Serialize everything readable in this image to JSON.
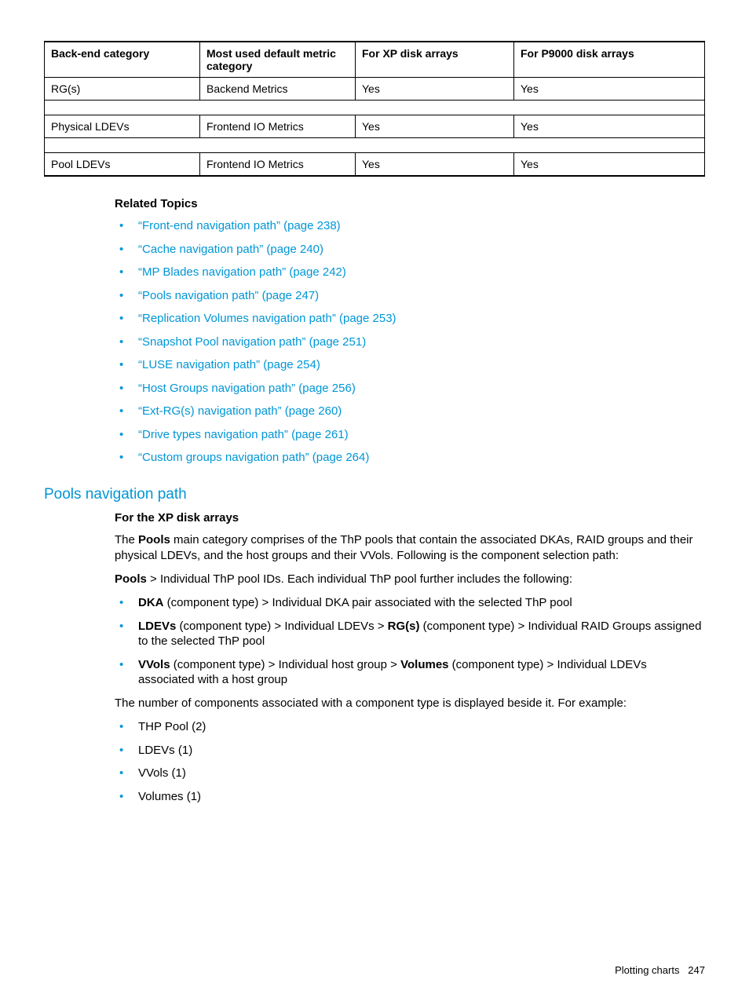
{
  "table": {
    "headers": [
      "Back-end category",
      "Most used default metric category",
      "For XP disk arrays",
      "For P9000 disk arrays"
    ],
    "rows": [
      [
        "RG(s)",
        "Backend Metrics",
        "Yes",
        "Yes"
      ],
      [
        "Physical LDEVs",
        "Frontend IO Metrics",
        "Yes",
        "Yes"
      ],
      [
        "Pool LDEVs",
        "Frontend IO Metrics",
        "Yes",
        "Yes"
      ]
    ]
  },
  "related": {
    "heading": "Related Topics",
    "items": [
      "“Front-end navigation path” (page 238)",
      "“Cache navigation path” (page 240)",
      "“MP Blades navigation path” (page 242)",
      "“Pools navigation path” (page 247)",
      "“Replication Volumes navigation path” (page 253)",
      "“Snapshot Pool navigation path” (page 251)",
      "“LUSE navigation path” (page 254)",
      "“Host Groups navigation path” (page 256)",
      "“Ext-RG(s) navigation path” (page 260)",
      "“Drive types navigation path” (page 261)",
      "“Custom groups navigation path” (page 264)"
    ]
  },
  "section": {
    "title": "Pools navigation path",
    "sub": "For the XP disk arrays",
    "p1_parts": [
      "The ",
      "Pools",
      " main category comprises of the ThP pools that contain the associated DKAs, RAID groups and their physical LDEVs, and the host groups and their VVols. Following is the component selection path:"
    ],
    "p2_parts": [
      "Pools",
      " > Individual ThP pool IDs. Each individual ThP pool further includes the following:"
    ],
    "list1": [
      {
        "parts": [
          [
            "b",
            "DKA"
          ],
          [
            "t",
            " (component type) > Individual DKA pair associated with the selected ThP pool"
          ]
        ]
      },
      {
        "parts": [
          [
            "b",
            "LDEVs"
          ],
          [
            "t",
            " (component type) > Individual LDEVs > "
          ],
          [
            "b",
            "RG(s)"
          ],
          [
            "t",
            " (component type) > Individual RAID Groups assigned to the selected ThP pool"
          ]
        ]
      },
      {
        "parts": [
          [
            "b",
            "VVols"
          ],
          [
            "t",
            " (component type) > Individual host group > "
          ],
          [
            "b",
            "Volumes"
          ],
          [
            "t",
            " (component type) > Individual LDEVs associated with a host group"
          ]
        ]
      }
    ],
    "p3": "The number of components associated with a component type is displayed beside it. For example:",
    "list2": [
      "THP Pool (2)",
      "LDEVs (1)",
      "VVols (1)",
      "Volumes (1)"
    ]
  },
  "footer": {
    "label": "Plotting charts",
    "page": "247"
  }
}
